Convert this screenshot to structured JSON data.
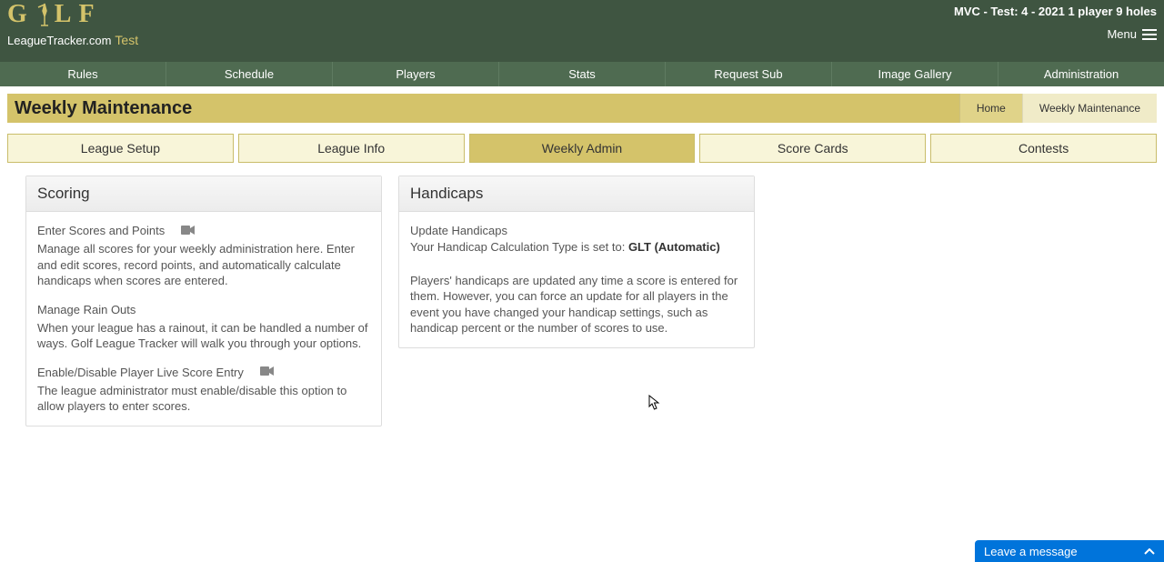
{
  "header": {
    "logo": {
      "word": "G   LF",
      "tracker": "LeagueTracker.com",
      "test": "Test"
    },
    "session": "MVC - Test: 4 - 2021 1 player 9 holes",
    "menu_label": "Menu"
  },
  "nav": [
    "Rules",
    "Schedule",
    "Players",
    "Stats",
    "Request Sub",
    "Image Gallery",
    "Administration"
  ],
  "titlebar": {
    "title": "Weekly Maintenance",
    "breadcrumbs": [
      {
        "label": "Home",
        "active": false
      },
      {
        "label": "Weekly Maintenance",
        "active": true
      }
    ]
  },
  "tabs": [
    {
      "label": "League Setup",
      "active": false
    },
    {
      "label": "League Info",
      "active": false
    },
    {
      "label": "Weekly Admin",
      "active": true
    },
    {
      "label": "Score Cards",
      "active": false
    },
    {
      "label": "Contests",
      "active": false
    }
  ],
  "panels": {
    "scoring": {
      "title": "Scoring",
      "items": [
        {
          "link": "Enter Scores and Points",
          "video": true,
          "desc": "Manage all scores for your weekly administration here. Enter and edit scores, record points, and automatically calculate handicaps when scores are entered."
        },
        {
          "link": "Manage Rain Outs",
          "video": false,
          "desc": "When your league has a rainout, it can be handled a number of ways. Golf League Tracker will walk you through your options."
        },
        {
          "link": "Enable/Disable Player Live Score Entry",
          "video": true,
          "desc": "The league administrator must enable/disable this option to allow players to enter scores."
        }
      ]
    },
    "handicaps": {
      "title": "Handicaps",
      "update_link": "Update Handicaps",
      "calc_prefix": "Your Handicap Calculation Type is set to: ",
      "calc_value": "GLT (Automatic)",
      "note": "Players' handicaps are updated any time a score is entered for them. However, you can force an update for all players in the event you have changed your handicap settings, such as handicap percent or the number of scores to use."
    }
  },
  "chat": {
    "label": "Leave a message"
  }
}
